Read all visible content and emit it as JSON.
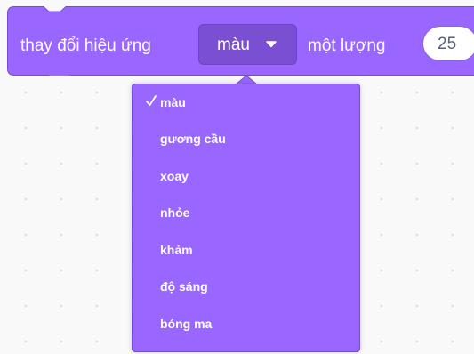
{
  "block": {
    "label": "thay đổi hiệu ứng",
    "selected_effect": "màu",
    "amount_label": "một lượng",
    "amount_value": "25"
  },
  "dropdown": {
    "items": [
      {
        "label": "màu",
        "selected": true
      },
      {
        "label": "gương cầu"
      },
      {
        "label": "xoay"
      },
      {
        "label": "nhỏe"
      },
      {
        "label": "khảm"
      },
      {
        "label": "độ sáng"
      },
      {
        "label": "bóng ma"
      }
    ]
  },
  "icons": {
    "caret": "caret-down-icon",
    "check": "check-icon"
  },
  "colors": {
    "block_fill": "#9966ff",
    "block_border": "#774dcb",
    "dropdown_fill": "#7a4fd1",
    "text_on_block": "#ffffff",
    "input_text": "#575e75",
    "workspace_bg": "#f9f9f9"
  }
}
